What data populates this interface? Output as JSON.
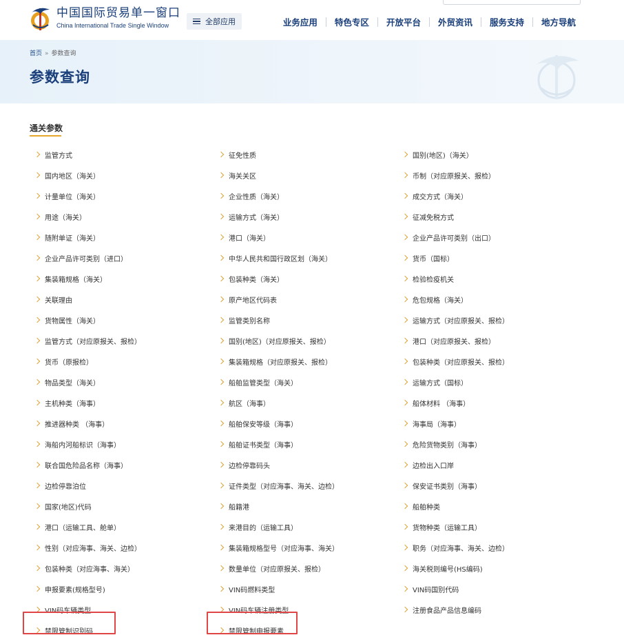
{
  "header": {
    "brand_cn": "中国国际贸易单一窗口",
    "brand_en": "China International Trade Single Window",
    "all_apps_label": "全部应用",
    "nav": [
      "业务应用",
      "特色专区",
      "开放平台",
      "外贸资讯",
      "服务支持",
      "地方导航"
    ]
  },
  "breadcrumb": {
    "home": "首页",
    "separator": "»",
    "current": "参数查询"
  },
  "page_title": "参数查询",
  "section": {
    "title": "通关参数",
    "columns": [
      [
        "监管方式",
        "国内地区（海关）",
        "计量单位（海关）",
        "用途（海关）",
        "随附单证（海关）",
        "企业产品许可类别（进口）",
        "集装箱规格（海关）",
        "关联理由",
        "货物属性（海关）",
        "监管方式（对应原报关、报检）",
        "货币（原报检）",
        "物品类型（海关）",
        "主机种类（海事）",
        "推进器种类 （海事）",
        "海船内河船标识（海事）",
        "联合国危险品名称（海事）",
        "边检停靠泊位",
        "国家(地区)代码",
        "港口（运输工具、舱单）",
        "性别（对应海事、海关、边检）",
        "包装种类（对应海事、海关）",
        "申报要素(规格型号)",
        "VIN码车辆类型",
        "禁限管制识别码"
      ],
      [
        "征免性质",
        "海关关区",
        "企业性质（海关）",
        "运输方式（海关）",
        "港口（海关）",
        "中华人民共和国行政区划（海关）",
        "包装种类（海关）",
        "原产地区代码表",
        "监管类别名称",
        "国别(地区)（对应原报关、报检）",
        "集装箱规格（对应原报关、报检）",
        "船舶监管类型（海关）",
        "航区（海事）",
        "船舶保安等级（海事）",
        "船舶证书类型（海事）",
        "边检停靠码头",
        "证件类型（对应海事、海关、边检）",
        "船籍港",
        "来港目的（运输工具）",
        "集装箱规格型号（对应海事、海关）",
        "数量单位（对应原报关、报检）",
        "VIN码燃料类型",
        "VIN码车辆注册类型",
        "禁限管制申报要素"
      ],
      [
        "国别(地区)（海关）",
        "币制（对应原报关、报检）",
        "成交方式（海关）",
        "征减免税方式",
        "企业产品许可类别（出口）",
        "货币（国标）",
        "检验检疫机关",
        "危包规格（海关）",
        "运输方式（对应原报关、报检）",
        "港口（对应原报关、报检）",
        "包装种类（对应原报关、报检）",
        "运输方式（国标）",
        "船体材料 （海事）",
        "海事局（海事）",
        "危险货物类别（海事）",
        "边检出入口岸",
        "保安证书类别（海事）",
        "船舶种类",
        "货物种类（运输工具）",
        "职务（对应海事、海关、边检）",
        "海关税则编号(HS编码)",
        "VIN码国别代码",
        "注册食品产品信息编码"
      ]
    ]
  },
  "colors": {
    "brand_blue": "#1a3f7a",
    "accent_gold": "#e6a62a",
    "highlight_red": "#e04545"
  },
  "icons": {
    "menu": "hamburger-icon",
    "bullet": "chevron-right-icon",
    "logo": "emblem-icon"
  },
  "highlighted_items": [
    "禁限管制识别码",
    "禁限管制申报要素"
  ]
}
